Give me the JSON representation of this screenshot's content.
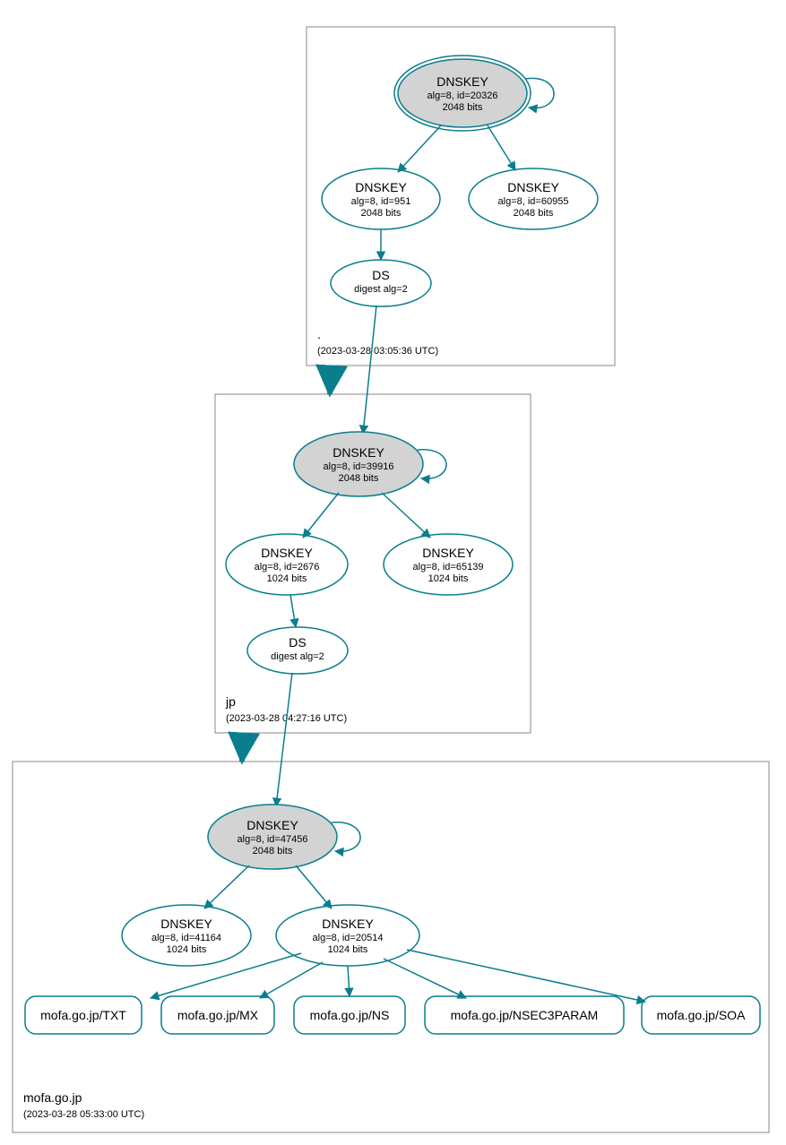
{
  "colors": {
    "teal": "#0a7e8c",
    "nodeFill": "#d3d3d3"
  },
  "zones": {
    "root": {
      "name": ".",
      "timestamp": "(2023-03-28 03:05:36 UTC)"
    },
    "jp": {
      "name": "jp",
      "timestamp": "(2023-03-28 04:27:16 UTC)"
    },
    "mofa": {
      "name": "mofa.go.jp",
      "timestamp": "(2023-03-28 05:33:00 UTC)"
    }
  },
  "nodes": {
    "root_ksk": {
      "title": "DNSKEY",
      "l1": "alg=8, id=20326",
      "l2": "2048 bits"
    },
    "root_zsk1": {
      "title": "DNSKEY",
      "l1": "alg=8, id=951",
      "l2": "2048 bits"
    },
    "root_zsk2": {
      "title": "DNSKEY",
      "l1": "alg=8, id=60955",
      "l2": "2048 bits"
    },
    "root_ds": {
      "title": "DS",
      "l1": "digest alg=2"
    },
    "jp_ksk": {
      "title": "DNSKEY",
      "l1": "alg=8, id=39916",
      "l2": "2048 bits"
    },
    "jp_zsk1": {
      "title": "DNSKEY",
      "l1": "alg=8, id=2676",
      "l2": "1024 bits"
    },
    "jp_zsk2": {
      "title": "DNSKEY",
      "l1": "alg=8, id=65139",
      "l2": "1024 bits"
    },
    "jp_ds": {
      "title": "DS",
      "l1": "digest alg=2"
    },
    "mofa_ksk": {
      "title": "DNSKEY",
      "l1": "alg=8, id=47456",
      "l2": "2048 bits"
    },
    "mofa_zsk1": {
      "title": "DNSKEY",
      "l1": "alg=8, id=41164",
      "l2": "1024 bits"
    },
    "mofa_zsk2": {
      "title": "DNSKEY",
      "l1": "alg=8, id=20514",
      "l2": "1024 bits"
    },
    "rr_txt": {
      "label": "mofa.go.jp/TXT"
    },
    "rr_mx": {
      "label": "mofa.go.jp/MX"
    },
    "rr_ns": {
      "label": "mofa.go.jp/NS"
    },
    "rr_nsec3": {
      "label": "mofa.go.jp/NSEC3PARAM"
    },
    "rr_soa": {
      "label": "mofa.go.jp/SOA"
    }
  }
}
